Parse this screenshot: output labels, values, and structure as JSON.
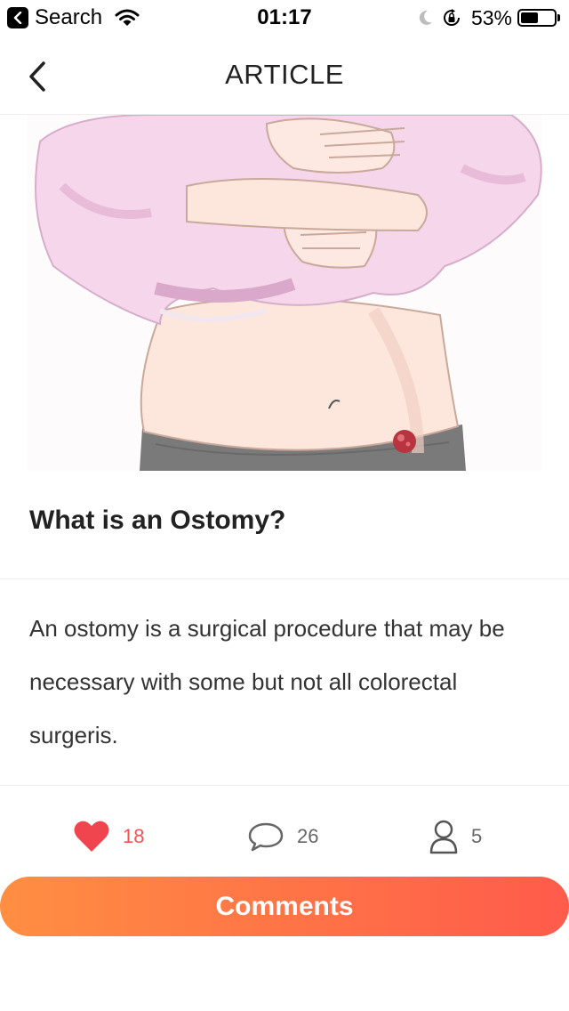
{
  "status_bar": {
    "back_app": "Search",
    "time": "01:17",
    "battery_percent": "53%",
    "battery_level": 0.53
  },
  "nav": {
    "title": "ARTICLE"
  },
  "article": {
    "title": "What is an Ostomy?",
    "body": "An ostomy is a surgical procedure that may be necessary with some but not all colorectal surgeris."
  },
  "stats": {
    "likes": "18",
    "comments": "26",
    "views": "5"
  },
  "colors": {
    "accent_start": "#ff8e42",
    "accent_end": "#ff5b4b",
    "like": "#f05555"
  },
  "actions": {
    "comments_label": "Comments"
  }
}
